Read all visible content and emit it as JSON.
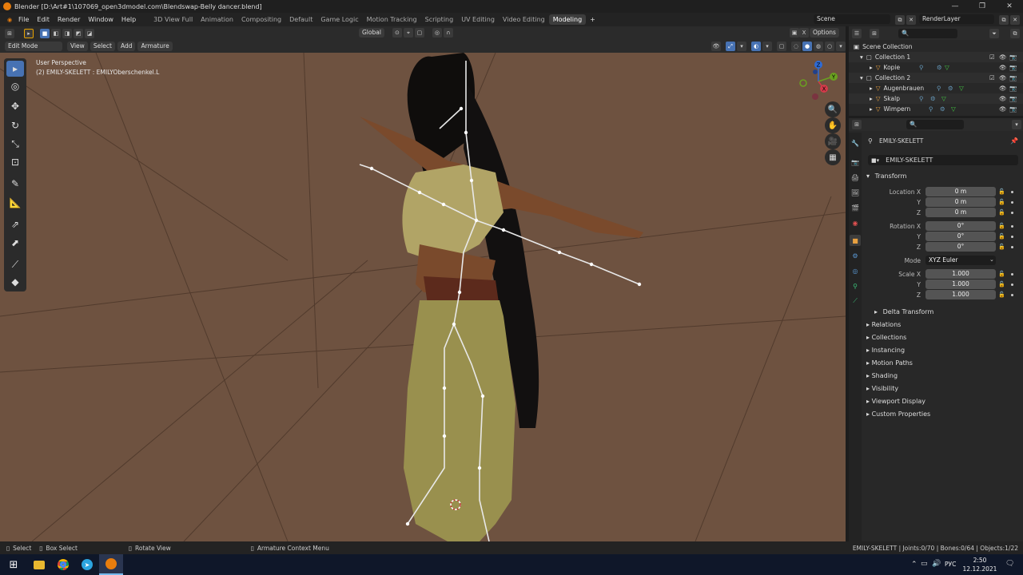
{
  "window": {
    "title": "Blender [D:\\Art#1\\107069_open3dmodel.com\\Blendswap-Belly dancer.blend]"
  },
  "menu": {
    "items": [
      "File",
      "Edit",
      "Render",
      "Window",
      "Help"
    ]
  },
  "workspaces": [
    "3D View Full",
    "Animation",
    "Compositing",
    "Default",
    "Game Logic",
    "Motion Tracking",
    "Scripting",
    "UV Editing",
    "Video Editing",
    "Modeling"
  ],
  "active_workspace": "Modeling",
  "scene": {
    "name": "Scene",
    "render_layer": "RenderLayer"
  },
  "header3d": {
    "transform": "Global",
    "options": "Options"
  },
  "header3d2": {
    "mode": "Edit Mode",
    "view": "View",
    "select": "Select",
    "add": "Add",
    "armature": "Armature"
  },
  "viewport": {
    "perspective": "User Perspective",
    "object": "(2) EMILY-SKELETT : EMILYOberschenkel.L"
  },
  "gizmo": {
    "x": "X",
    "y": "Y",
    "z": "Z"
  },
  "outliner": {
    "root": "Scene Collection",
    "rows": [
      {
        "label": "Collection 1",
        "indent": 1,
        "kind": "collection"
      },
      {
        "label": "Kopie",
        "indent": 2,
        "kind": "object"
      },
      {
        "label": "Collection 2",
        "indent": 1,
        "kind": "collection"
      },
      {
        "label": "Augenbrauen",
        "indent": 2,
        "kind": "object"
      },
      {
        "label": "Skalp",
        "indent": 2,
        "kind": "object"
      },
      {
        "label": "Wimpern",
        "indent": 2,
        "kind": "object"
      }
    ]
  },
  "properties": {
    "object_name": "EMILY-SKELETT",
    "breadcrumb": "EMILY-SKELETT",
    "transform_title": "Transform",
    "location": {
      "label": "Location X",
      "x": "0 m",
      "y": "0 m",
      "z": "0 m"
    },
    "rotation": {
      "label": "Rotation X",
      "x": "0°",
      "y": "0°",
      "z": "0°"
    },
    "mode_label": "Mode",
    "mode_value": "XYZ Euler",
    "scale": {
      "label": "Scale X",
      "x": "1.000",
      "y": "1.000",
      "z": "1.000"
    },
    "axis_y": "Y",
    "axis_z": "Z",
    "delta": "Delta Transform",
    "sections": [
      "Relations",
      "Collections",
      "Instancing",
      "Motion Paths",
      "Shading",
      "Visibility",
      "Viewport Display",
      "Custom Properties"
    ]
  },
  "status": {
    "select": "Select",
    "box_select": "Box Select",
    "rotate": "Rotate View",
    "context": "Armature Context Menu",
    "stats": "EMILY-SKELETT | Joints:0/70 | Bones:0/64 | Objects:1/22"
  },
  "taskbar": {
    "lang": "РУС",
    "time": "2:50",
    "date": "12.12.2021"
  },
  "colors": {
    "accent": "#4772b3",
    "viewport_bg": "#6e5240",
    "blender_orange": "#e87d0d"
  }
}
